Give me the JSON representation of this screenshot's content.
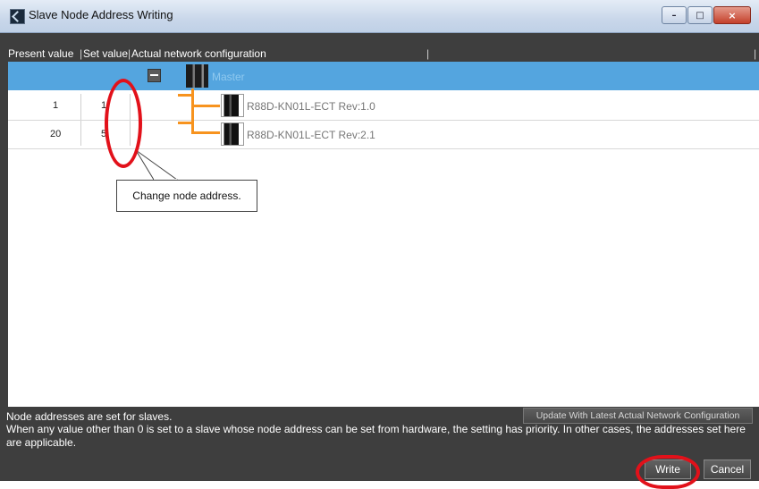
{
  "window": {
    "title": "Slave Node Address Writing",
    "title_icon": "app-icon",
    "controls": {
      "minimize": "–",
      "maximize": "□",
      "close": "×"
    }
  },
  "columns": {
    "present": "Present value",
    "set": "Set value",
    "actual": "Actual network configuration"
  },
  "tree": {
    "master": {
      "label": "Master",
      "icon": "master-unit-icon"
    },
    "slaves": [
      {
        "present_value": "1",
        "set_value": "1",
        "label": "R88D-KN01L-ECT Rev:1.0",
        "icon": "servo-drive-icon"
      },
      {
        "present_value": "20",
        "set_value": "5",
        "label": "R88D-KN01L-ECT Rev:2.1",
        "icon": "servo-drive-icon"
      }
    ]
  },
  "annotation": {
    "callout": "Change node address."
  },
  "footer": {
    "status": "Node addresses are set for slaves.",
    "description": "When any value other than 0 is set to a slave whose node address can be set from hardware, the setting has priority. In other cases, the addresses set here are applicable.",
    "update_button": "Update With Latest Actual Network Configuration",
    "write_button": "Write",
    "cancel_button": "Cancel"
  },
  "colors": {
    "selection": "#54a5df",
    "tree_line": "#f7931e",
    "highlight": "#e2111a",
    "background": "#3e3e3e"
  }
}
